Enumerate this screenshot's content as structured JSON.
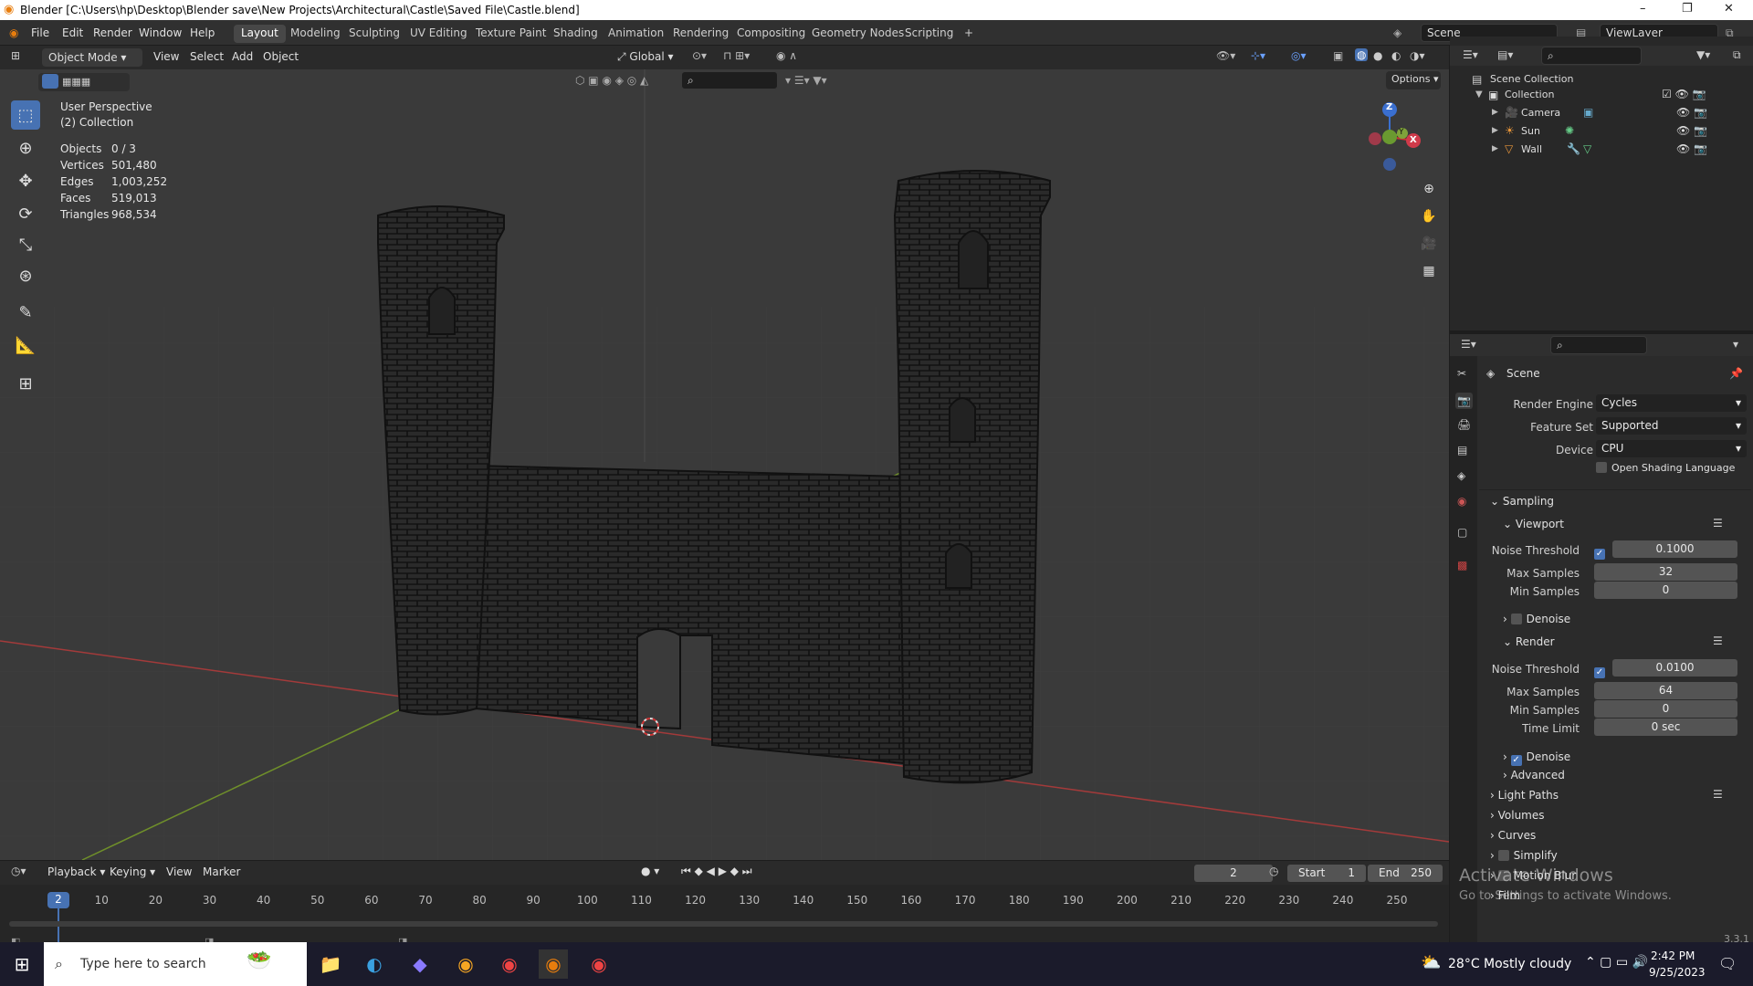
{
  "window": {
    "title": "Blender [C:\\Users\\hp\\Desktop\\Blender save\\New Projects\\Architectural\\Castle\\Saved File\\Castle.blend]",
    "min": "–",
    "max": "❐",
    "close": "✕"
  },
  "menu": {
    "items": [
      "File",
      "Edit",
      "Render",
      "Window",
      "Help"
    ]
  },
  "workspaces": [
    "Layout",
    "Modeling",
    "Sculpting",
    "UV Editing",
    "Texture Paint",
    "Shading",
    "Animation",
    "Rendering",
    "Compositing",
    "Geometry Nodes",
    "Scripting"
  ],
  "add_tab": "+",
  "scene_field": "Scene",
  "viewlayer_field": "ViewLayer",
  "viewport_header": {
    "mode": "Object Mode",
    "menus": [
      "View",
      "Select",
      "Add",
      "Object"
    ],
    "transform": "Global",
    "options": "Options"
  },
  "overlay": {
    "view_name": "User Perspective",
    "collection": "(2) Collection",
    "stats": [
      {
        "label": "Objects",
        "value": "0 / 3"
      },
      {
        "label": "Vertices",
        "value": "501,480"
      },
      {
        "label": "Edges",
        "value": "1,003,252"
      },
      {
        "label": "Faces",
        "value": "519,013"
      },
      {
        "label": "Triangles",
        "value": "968,534"
      }
    ]
  },
  "gizmo": {
    "z": "Z",
    "y": "Y",
    "x": "X"
  },
  "outliner": {
    "root": "Scene Collection",
    "collection": "Collection",
    "items": [
      "Camera",
      "Sun",
      "Wall"
    ]
  },
  "props": {
    "scene": "Scene",
    "render_engine": {
      "label": "Render Engine",
      "value": "Cycles"
    },
    "feature_set": {
      "label": "Feature Set",
      "value": "Supported"
    },
    "device": {
      "label": "Device",
      "value": "CPU"
    },
    "osl": "Open Shading Language",
    "sampling": "Sampling",
    "viewport": {
      "title": "Viewport",
      "noise_label": "Noise Threshold",
      "noise": "0.1000",
      "max_label": "Max Samples",
      "max": "32",
      "min_label": "Min Samples",
      "min": "0",
      "denoise": "Denoise"
    },
    "render": {
      "title": "Render",
      "noise_label": "Noise Threshold",
      "noise": "0.0100",
      "max_label": "Max Samples",
      "max": "64",
      "min_label": "Min Samples",
      "min": "0",
      "time_label": "Time Limit",
      "time": "0 sec",
      "denoise": "Denoise"
    },
    "advanced": "Advanced",
    "light_paths": "Light Paths",
    "volumes": "Volumes",
    "curves": "Curves",
    "simplify": "Simplify",
    "motion_blur": "Motion Blur",
    "film": "Film"
  },
  "activate": {
    "title": "Activate Windows",
    "sub": "Go to Settings to activate Windows."
  },
  "timeline": {
    "menus": [
      "Playback",
      "Keying",
      "View",
      "Marker"
    ],
    "current_frame": "2",
    "start_label": "Start",
    "start": "1",
    "end_label": "End",
    "end": "250",
    "ticks": [
      "2",
      "10",
      "20",
      "30",
      "40",
      "50",
      "60",
      "70",
      "80",
      "90",
      "100",
      "110",
      "120",
      "130",
      "140",
      "150",
      "160",
      "170",
      "180",
      "190",
      "200",
      "210",
      "220",
      "230",
      "240",
      "250"
    ]
  },
  "version": "3.3.1",
  "taskbar": {
    "search_placeholder": "Type here to search",
    "weather": "28°C  Mostly cloudy",
    "time": "2:42 PM",
    "date": "9/25/2023"
  }
}
